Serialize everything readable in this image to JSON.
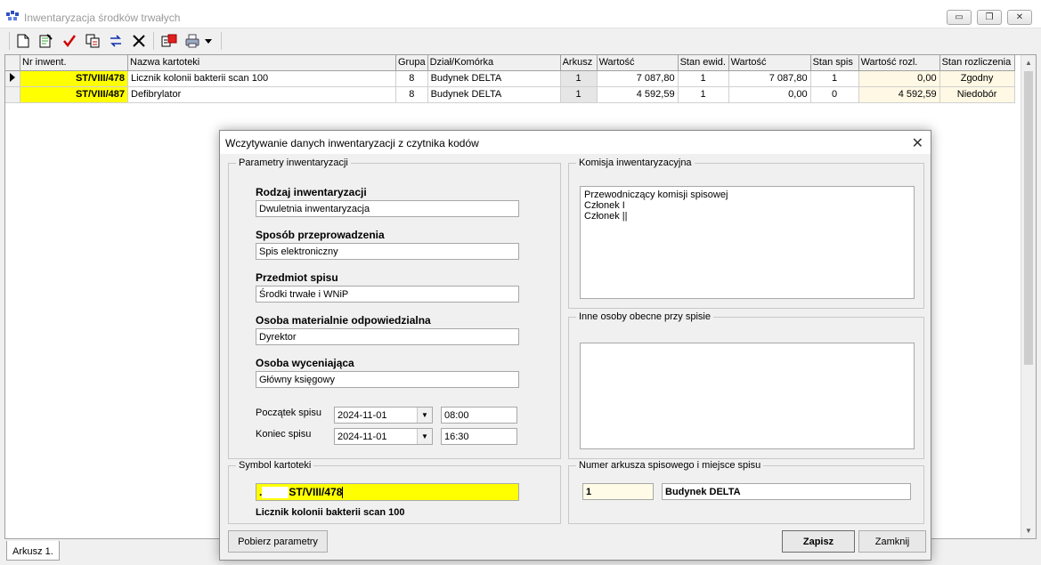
{
  "window": {
    "title": "Inwentaryzacja środków trwałych",
    "controls": {
      "minimize": "▭",
      "restore": "❐",
      "close": "✕"
    }
  },
  "toolbar": {
    "icons": [
      "new-document-icon",
      "edit-document-icon",
      "check-icon",
      "copy-icon",
      "swap-icon",
      "delete-icon",
      "import-icon",
      "printer-icon",
      "dropdown-icon"
    ]
  },
  "grid": {
    "columns": [
      "Nr inwent.",
      "Nazwa kartoteki",
      "Grupa",
      "Dział/Komórka",
      "Arkusz",
      "Wartość",
      "Stan ewid.",
      "Wartość",
      "Stan spis",
      "Wartość rozl.",
      "Stan rozliczenia"
    ],
    "rows": [
      {
        "nr": "ST/VIII/478",
        "nazwa": "Licznik kolonii bakterii scan 100",
        "grupa": "8",
        "dzial": "Budynek DELTA",
        "arkusz": "1",
        "wartosc": "7 087,80",
        "stan_ewid": "1",
        "wartosc2": "7 087,80",
        "stan_spis": "1",
        "wartosc_rozl": "0,00",
        "stan_rozl": "Zgodny"
      },
      {
        "nr": "ST/VIII/487",
        "nazwa": "Defibrylator",
        "grupa": "8",
        "dzial": "Budynek DELTA",
        "arkusz": "1",
        "wartosc": "4 592,59",
        "stan_ewid": "1",
        "wartosc2": "0,00",
        "stan_spis": "0",
        "wartosc_rozl": "4 592,59",
        "stan_rozl": "Niedobór"
      }
    ]
  },
  "tabs": {
    "active": "Arkusz 1."
  },
  "dialog": {
    "title": "Wczytywanie danych inwentaryzacji z czytnika kodów",
    "params": {
      "legend": "Parametry inwentaryzacji",
      "rodzaj_label": "Rodzaj inwentaryzacji",
      "rodzaj_value": "Dwuletnia inwentaryzacja",
      "sposob_label": "Sposób przeprowadzenia",
      "sposob_value": "Spis elektroniczny",
      "przedmiot_label": "Przedmiot spisu",
      "przedmiot_value": "Środki trwałe i WNiP",
      "osoba_mat_label": "Osoba materialnie odpowiedzialna",
      "osoba_mat_value": "Dyrektor",
      "osoba_wyc_label": "Osoba wyceniająca",
      "osoba_wyc_value": "Główny księgowy",
      "poczatek_label": "Początek spisu",
      "poczatek_date": "2024-11-01",
      "poczatek_time": "08:00",
      "koniec_label": "Koniec spisu",
      "koniec_date": "2024-11-01",
      "koniec_time": "16:30"
    },
    "komisja": {
      "legend": "Komisja inwentaryzacyjna",
      "lines": [
        "Przewodniczący komisji spisowej",
        "Członek I",
        "Członek ||"
      ]
    },
    "inne": {
      "legend": "Inne osoby obecne przy spisie"
    },
    "symbol": {
      "legend": "Symbol kartoteki",
      "prefix": ".",
      "value": "ST/VIII/478",
      "name": "Licznik kolonii bakterii scan 100"
    },
    "numer": {
      "legend": "Numer arkusza spisowego i miejsce spisu",
      "arkusz": "1",
      "miejsce": "Budynek DELTA"
    },
    "buttons": {
      "pobierz": "Pobierz parametry",
      "zapisz": "Zapisz",
      "zamknij": "Zamknij"
    },
    "close_glyph": "✕"
  },
  "colors": {
    "highlight": "#ffff00",
    "accent_cell": "#fff8e4"
  }
}
